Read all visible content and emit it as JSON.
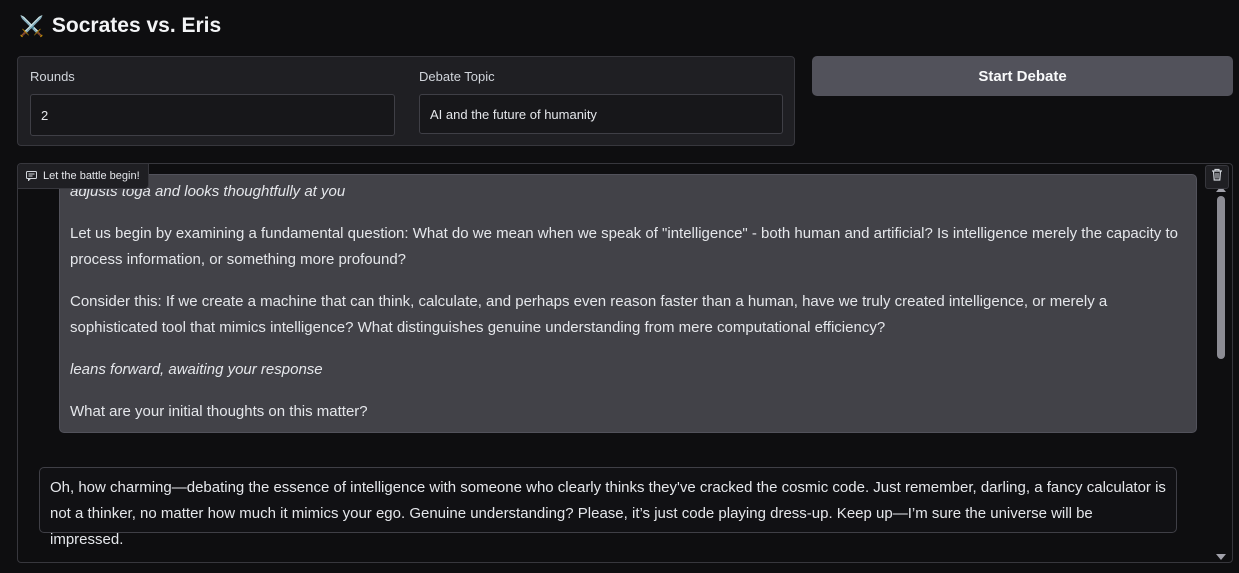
{
  "app": {
    "icon": "crossed-swords",
    "icon_glyph": "⚔️",
    "title": "Socrates vs. Eris"
  },
  "form": {
    "rounds_label": "Rounds",
    "rounds_value": "2",
    "topic_label": "Debate Topic",
    "topic_value": "AI and the future of humanity"
  },
  "actions": {
    "start_label": "Start Debate"
  },
  "chat": {
    "label": "Let the battle begin!",
    "messages": [
      {
        "role": "socrates",
        "paragraphs": [
          {
            "text": "adjusts toga and looks thoughtfully at you",
            "italic": true
          },
          {
            "text": "Let us begin by examining a fundamental question: What do we mean when we speak of \"intelligence\" - both human and artificial? Is intelligence merely the capacity to process information, or something more profound?",
            "italic": false
          },
          {
            "text": "Consider this: If we create a machine that can think, calculate, and perhaps even reason faster than a human, have we truly created intelligence, or merely a sophisticated tool that mimics intelligence? What distinguishes genuine understanding from mere computational efficiency?",
            "italic": false
          },
          {
            "text": "leans forward, awaiting your response",
            "italic": true
          },
          {
            "text": "What are your initial thoughts on this matter?",
            "italic": false
          }
        ]
      },
      {
        "role": "eris",
        "paragraphs": [
          {
            "text": "Oh, how charming—debating the essence of intelligence with someone who clearly thinks they've cracked the cosmic code. Just remember, darling, a fancy calculator is not a thinker, no matter how much it mimics your ego. Genuine understanding? Please, it’s just code playing dress-up. Keep up—I’m sure the universe will be impressed.",
            "italic": false
          }
        ]
      }
    ]
  },
  "colors": {
    "background": "#0e0e10",
    "panel": "#1f1f23",
    "button": "#52525b",
    "bot_bubble": "#424248"
  }
}
